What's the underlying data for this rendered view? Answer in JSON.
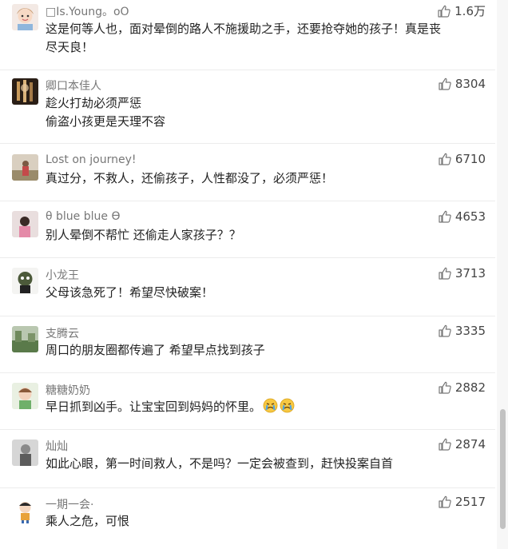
{
  "comments": [
    {
      "name": "□Is.Young。oO",
      "lines": [
        "这是何等人也，面对晕倒的路人不施援助之手，还要抢夺她的孩子！真是丧",
        "尽天良！"
      ],
      "likes": "1.6万",
      "avatar": "girl-cartoon"
    },
    {
      "name": "卿口本佳人",
      "lines": [
        "趁火打劫必须严惩",
        "偷盗小孩更是天理不容"
      ],
      "likes": "8304",
      "avatar": "dark-photo"
    },
    {
      "name": "Lost on journey!",
      "lines": [
        "真过分，不救人，还偷孩子，人性都没了，必须严惩！"
      ],
      "likes": "6710",
      "avatar": "outdoor-photo"
    },
    {
      "name": "θ blue blue ϴ",
      "lines": [
        "别人晕倒不帮忙 还偷走人家孩子？？"
      ],
      "likes": "4653",
      "avatar": "pink-photo"
    },
    {
      "name": "小龙王",
      "lines": [
        "父母该急死了！希望尽快破案！"
      ],
      "likes": "3713",
      "avatar": "cartoon-character"
    },
    {
      "name": "支腾云",
      "lines": [
        "周口的朋友圈都传遍了 希望早点找到孩子"
      ],
      "likes": "3335",
      "avatar": "landscape-photo"
    },
    {
      "name": "糖糖奶奶",
      "lines": [
        "早日抓到凶手。让宝宝回到妈妈的怀里。"
      ],
      "emoji": [
        "crying-face-emoji",
        "crying-face-emoji"
      ],
      "likes": "2882",
      "avatar": "baby-photo"
    },
    {
      "name": "灿灿",
      "lines": [
        "如此心眼，第一时间救人，不是吗？一定会被查到，赶快投案自首"
      ],
      "likes": "2874",
      "avatar": "grey-photo"
    },
    {
      "name": "一期一会·",
      "lines": [
        "乘人之危，可恨"
      ],
      "likes": "2517",
      "avatar": "cartoon-kid"
    }
  ],
  "icons": {
    "like": "thumbs-up-icon"
  },
  "colors": {
    "name": "#777777",
    "text": "#222222",
    "like_icon": "#777777"
  }
}
